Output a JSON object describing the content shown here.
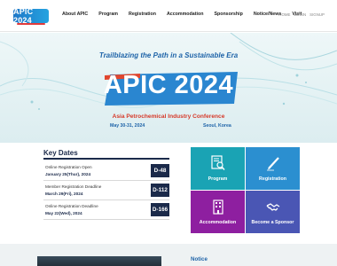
{
  "header": {
    "logo_text": "APIC 2024",
    "nav": [
      "About APIC",
      "Program",
      "Registration",
      "Accommodation",
      "Sponsorship",
      "Notice/News",
      "Visit"
    ],
    "util": [
      "HOME",
      "LOGIN",
      "SIGNUP"
    ]
  },
  "hero": {
    "tagline": "Trailblazing the Path in a Sustainable Era",
    "title": "APIC 2024",
    "subtitle": "Asia Petrochemical Industry Conference",
    "date": "May 30-31, 2024",
    "place": "Seoul, Korea"
  },
  "key_dates": {
    "title": "Key Dates",
    "items": [
      {
        "label": "Online Registration Open",
        "date": "January 25(Thur), 2024",
        "dday": "D-48"
      },
      {
        "label": "Member Registration Deadline",
        "date": "March 29(Fri), 2024",
        "dday": "D-112"
      },
      {
        "label": "Online Registration Deadline",
        "date": "May 22(Wed), 2024",
        "dday": "D-166"
      }
    ]
  },
  "tiles": [
    {
      "label": "Program",
      "icon": "document-search-icon",
      "color": "#1aa3b4"
    },
    {
      "label": "Registration",
      "icon": "pen-icon",
      "color": "#2b8fd0"
    },
    {
      "label": "Accommodation",
      "icon": "building-icon",
      "color": "#8e1fa0"
    },
    {
      "label": "Become a Sponsor",
      "icon": "handshake-icon",
      "color": "#4a56b4"
    }
  ],
  "notice": {
    "title": "Notice"
  },
  "colors": {
    "brand_blue": "#1e63a8",
    "navy": "#1b2a4a",
    "accent_red": "#d63a2a"
  }
}
